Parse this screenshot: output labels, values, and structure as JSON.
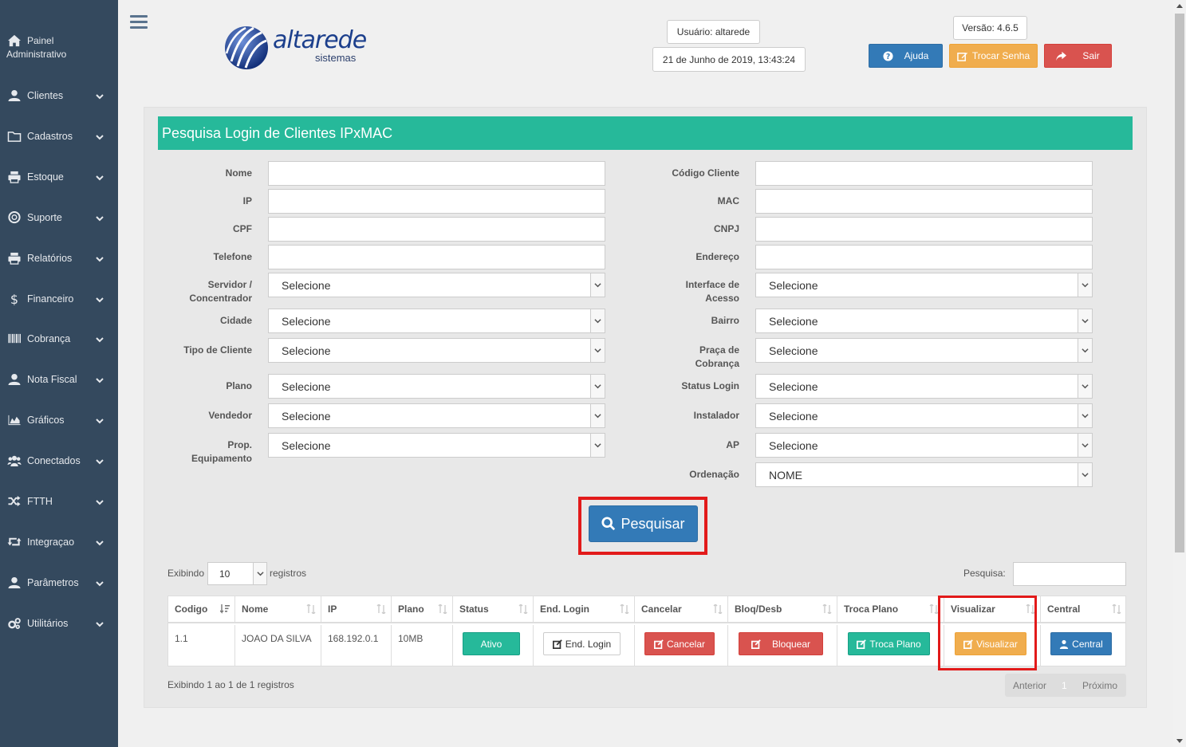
{
  "sidebar": {
    "home_line1": "Painel",
    "home_line2": "Administrativo",
    "items": [
      {
        "label": "Clientes",
        "icon": "user-icon"
      },
      {
        "label": "Cadastros",
        "icon": "folder-icon"
      },
      {
        "label": "Estoque",
        "icon": "printer-icon"
      },
      {
        "label": "Suporte",
        "icon": "lifebuoy-icon"
      },
      {
        "label": "Relatórios",
        "icon": "printer-icon"
      },
      {
        "label": "Financeiro",
        "icon": "dollar-icon"
      },
      {
        "label": "Cobrança",
        "icon": "barcode-icon"
      },
      {
        "label": "Nota Fiscal",
        "icon": "user-icon"
      },
      {
        "label": "Gráficos",
        "icon": "area-chart-icon"
      },
      {
        "label": "Conectados",
        "icon": "users-icon"
      },
      {
        "label": "FTTH",
        "icon": "random-icon"
      },
      {
        "label": "Integraçao",
        "icon": "retweet-icon"
      },
      {
        "label": "Parâmetros",
        "icon": "user-icon"
      },
      {
        "label": "Utilitários",
        "icon": "cogs-icon"
      }
    ]
  },
  "header": {
    "logo_text": "altarede",
    "logo_sub": "sistemas",
    "user": "Usuário: altarede",
    "datetime": "21 de Junho de 2019, 13:43:24",
    "version": "Versão: 4.6.5",
    "help_label": "Ajuda",
    "change_password_label": "Trocar Senha",
    "exit_label": "Sair",
    "colors": {
      "help": "#337ab7",
      "change_password": "#f0ad4e",
      "exit": "#d9534f"
    }
  },
  "form": {
    "title": "Pesquisa Login de Clientes IPxMAC",
    "left_labels": {
      "nome": "Nome",
      "ip": "IP",
      "cpf": "CPF",
      "telefone": "Telefone",
      "servidor_1": "Servidor /",
      "servidor_2": "Concentrador",
      "cidade": "Cidade",
      "tipo": "Tipo de Cliente",
      "plano": "Plano",
      "vendedor": "Vendedor",
      "prop_1": "Prop.",
      "prop_2": "Equipamento"
    },
    "right_labels": {
      "codigo": "Código Cliente",
      "mac": "MAC",
      "cnpj": "CNPJ",
      "endereco": "Endereço",
      "interface_1": "Interface de",
      "interface_2": "Acesso",
      "bairro": "Bairro",
      "praca_1": "Praça de",
      "praca_2": "Cobrança",
      "status": "Status Login",
      "instalador": "Instalador",
      "ap": "AP",
      "ordenacao": "Ordenação"
    },
    "select_default": "Selecione",
    "order_value": "NOME",
    "search_button": "Pesquisar"
  },
  "listing": {
    "showing_label": "Exibindo",
    "page_size": "10",
    "records_label": "registros",
    "search_label": "Pesquisa:",
    "columns": [
      "Codigo",
      "Nome",
      "IP",
      "Plano",
      "Status",
      "End. Login",
      "Cancelar",
      "Bloq/Desb",
      "Troca Plano",
      "Visualizar",
      "Central"
    ],
    "row": {
      "codigo": "1.1",
      "nome": "JOAO DA SILVA",
      "ip": "168.192.0.1",
      "plano": "10MB",
      "status": "Ativo",
      "end_login": "End. Login",
      "cancelar": "Cancelar",
      "bloquear": "Bloquear",
      "troca_plano": "Troca Plano",
      "visualizar": "Visualizar",
      "central": "Central"
    },
    "summary": "Exibindo 1 ao 1 de 1 registros",
    "pager_prev": "Anterior",
    "pager_page": "1",
    "pager_next": "Próximo"
  }
}
